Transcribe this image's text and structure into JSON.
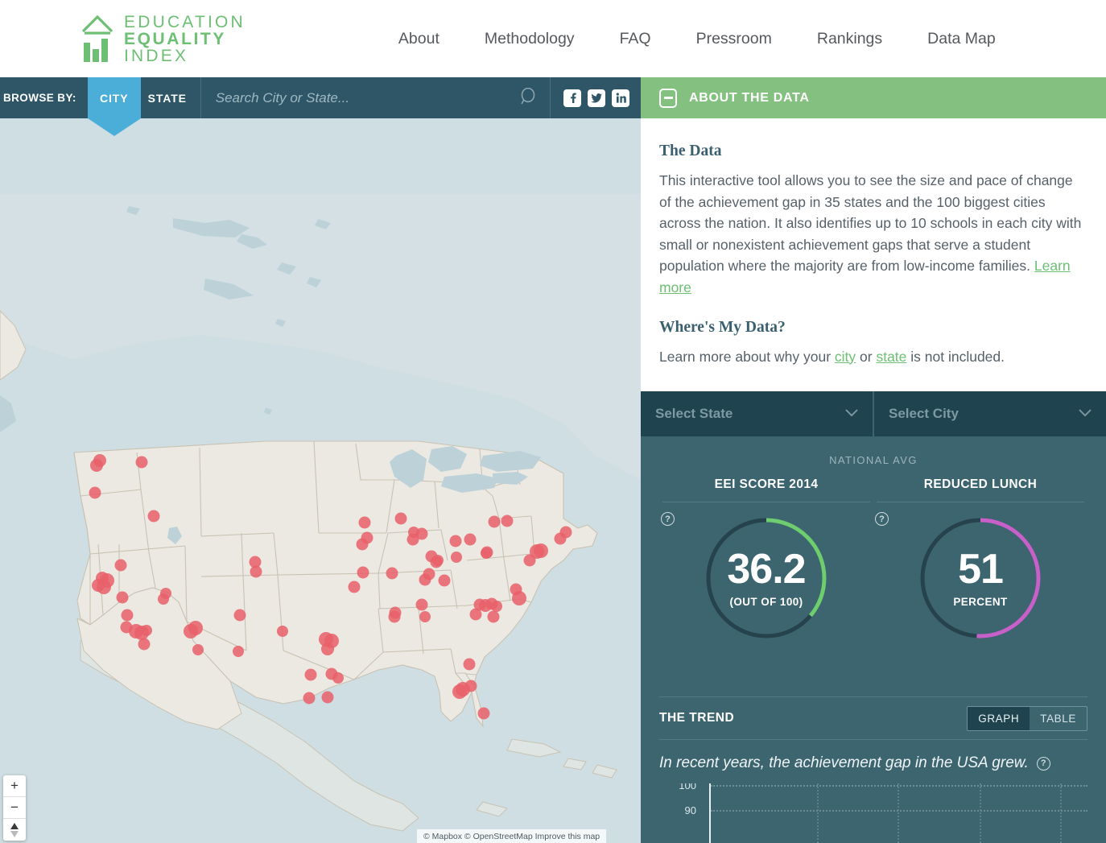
{
  "header": {
    "logo": {
      "line1": "EDUCATION",
      "line2": "EQUALITY",
      "line3": "INDEX",
      "icon": "house-bar-chart-logo"
    },
    "nav": [
      {
        "label": "About"
      },
      {
        "label": "Methodology"
      },
      {
        "label": "FAQ"
      },
      {
        "label": "Pressroom"
      },
      {
        "label": "Rankings"
      },
      {
        "label": "Data Map"
      }
    ]
  },
  "browse": {
    "label": "BROWSE BY:",
    "tabs": [
      {
        "label": "CITY",
        "active": true
      },
      {
        "label": "STATE",
        "active": false
      }
    ],
    "search_placeholder": "Search City or State...",
    "search_value": "",
    "social": [
      {
        "name": "facebook-icon",
        "glyph": "f"
      },
      {
        "name": "twitter-icon",
        "glyph": "t"
      },
      {
        "name": "linkedin-icon",
        "glyph": "in"
      }
    ]
  },
  "map": {
    "attribution": "© Mapbox © OpenStreetMap Improve this map",
    "zoom_in": "+",
    "zoom_out": "−",
    "compass": "compass-control"
  },
  "panel": {
    "header_title": "ABOUT THE DATA",
    "collapse_icon": "minus-icon",
    "accent_green": "#84c07f",
    "sections": [
      {
        "title": "The Data",
        "text_before": "This interactive tool allows you to see the size and pace of change of the achievement gap in 35 states and the 100 biggest cities across the nation. It also identifies up to 10 schools in each city with small or nonexistent achievement gaps that serve a student population where the majority are from low-income families.",
        "link": "Learn more"
      },
      {
        "title": "Where's My Data?",
        "lead": "Learn more about why your ",
        "link_city": "city",
        "mid": " or ",
        "link_state": "state",
        "tail": " is not included."
      }
    ],
    "selects": {
      "state": {
        "label": "Select State",
        "chevron": "chevron-down-icon"
      },
      "city": {
        "label": "Select City",
        "chevron": "chevron-down-icon"
      }
    },
    "stats": {
      "scope_label": "NATIONAL AVG",
      "metrics": [
        {
          "title": "EEI SCORE 2014",
          "value": "36.2",
          "sub": "(OUT OF 100)",
          "percent": 36.2,
          "color": "#6ecd6e",
          "help": "?"
        },
        {
          "title": "REDUCED LUNCH",
          "value": "51",
          "sub": "PERCENT",
          "percent": 51,
          "color": "#c760c8",
          "help": "?"
        }
      ]
    },
    "trend": {
      "title": "THE TREND",
      "toggle": [
        {
          "label": "GRAPH",
          "active": true
        },
        {
          "label": "TABLE",
          "active": false
        }
      ],
      "caption": "In recent years, the achievement gap in the USA grew.",
      "help": "?"
    }
  },
  "chart_data": {
    "type": "line",
    "title": "In recent years, the achievement gap in the USA grew.",
    "xlabel": "",
    "ylabel": "",
    "ylim": [
      0,
      100
    ],
    "visible_yticks": [
      100,
      90
    ],
    "grid": true,
    "series": [],
    "note": "Chart is cut off at the bottom of the viewport; only the 100 and 90 gridlines are visible."
  }
}
